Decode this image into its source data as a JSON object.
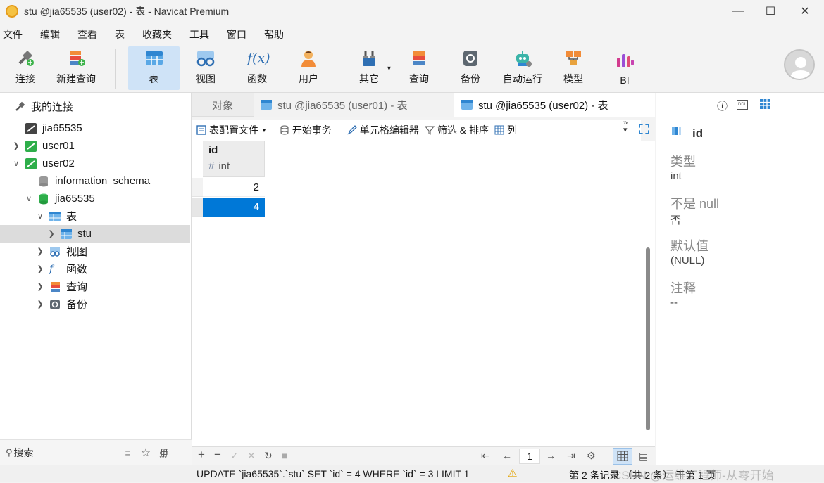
{
  "window": {
    "title": "stu @jia65535 (user02) - 表 - Navicat Premium"
  },
  "menu": [
    "文件",
    "编辑",
    "查看",
    "表",
    "收藏夹",
    "工具",
    "窗口",
    "帮助"
  ],
  "toolbar": {
    "connect": "连接",
    "new_query": "新建查询",
    "table": "表",
    "view": "视图",
    "function": "函数",
    "user": "用户",
    "other": "其它",
    "query": "查询",
    "backup": "备份",
    "automation": "自动运行",
    "model": "模型",
    "bi": "BI",
    "fx_glyph": "f(x)"
  },
  "sidebar": {
    "header": "我的连接",
    "items": [
      {
        "label": "jia65535"
      },
      {
        "label": "user01"
      },
      {
        "label": "user02"
      },
      {
        "label": "information_schema"
      },
      {
        "label": "jia65535"
      },
      {
        "label": "表"
      },
      {
        "label": "stu"
      },
      {
        "label": "视图"
      },
      {
        "label": "函数"
      },
      {
        "label": "查询"
      },
      {
        "label": "备份"
      }
    ],
    "search_placeholder": "搜索"
  },
  "tabs": [
    {
      "label": "对象"
    },
    {
      "label": "stu @jia65535 (user01) - 表"
    },
    {
      "label": "stu @jia65535 (user02) - 表"
    }
  ],
  "subtoolbar": {
    "table_config": "表配置文件",
    "begin_tx": "开始事务",
    "cell_editor": "单元格编辑器",
    "filter_sort": "筛选 & 排序",
    "columns": "列"
  },
  "grid": {
    "column": {
      "name": "id",
      "type": "int",
      "type_glyph": "#"
    },
    "rows": [
      "2",
      "4"
    ]
  },
  "pager": {
    "page": "1"
  },
  "status": {
    "sql": "UPDATE `jia65535`.`stu` SET `id` = 4 WHERE `id` = 3 LIMIT 1",
    "record_info": "第 2 条记录 （共 2 条） 于第 1 页",
    "watermark": "CSDN @运维工程师-从零开始"
  },
  "inspector": {
    "field_name": "id",
    "type_label": "类型",
    "type_value": "int",
    "not_null_label": "不是 null",
    "not_null_value": "否",
    "default_label": "默认值",
    "default_value": "(NULL)",
    "comment_label": "注释",
    "comment_value": "--"
  },
  "colors": {
    "selection": "#0078d7",
    "active_tool": "#cfe3f7",
    "accent": "#0a74c9"
  }
}
